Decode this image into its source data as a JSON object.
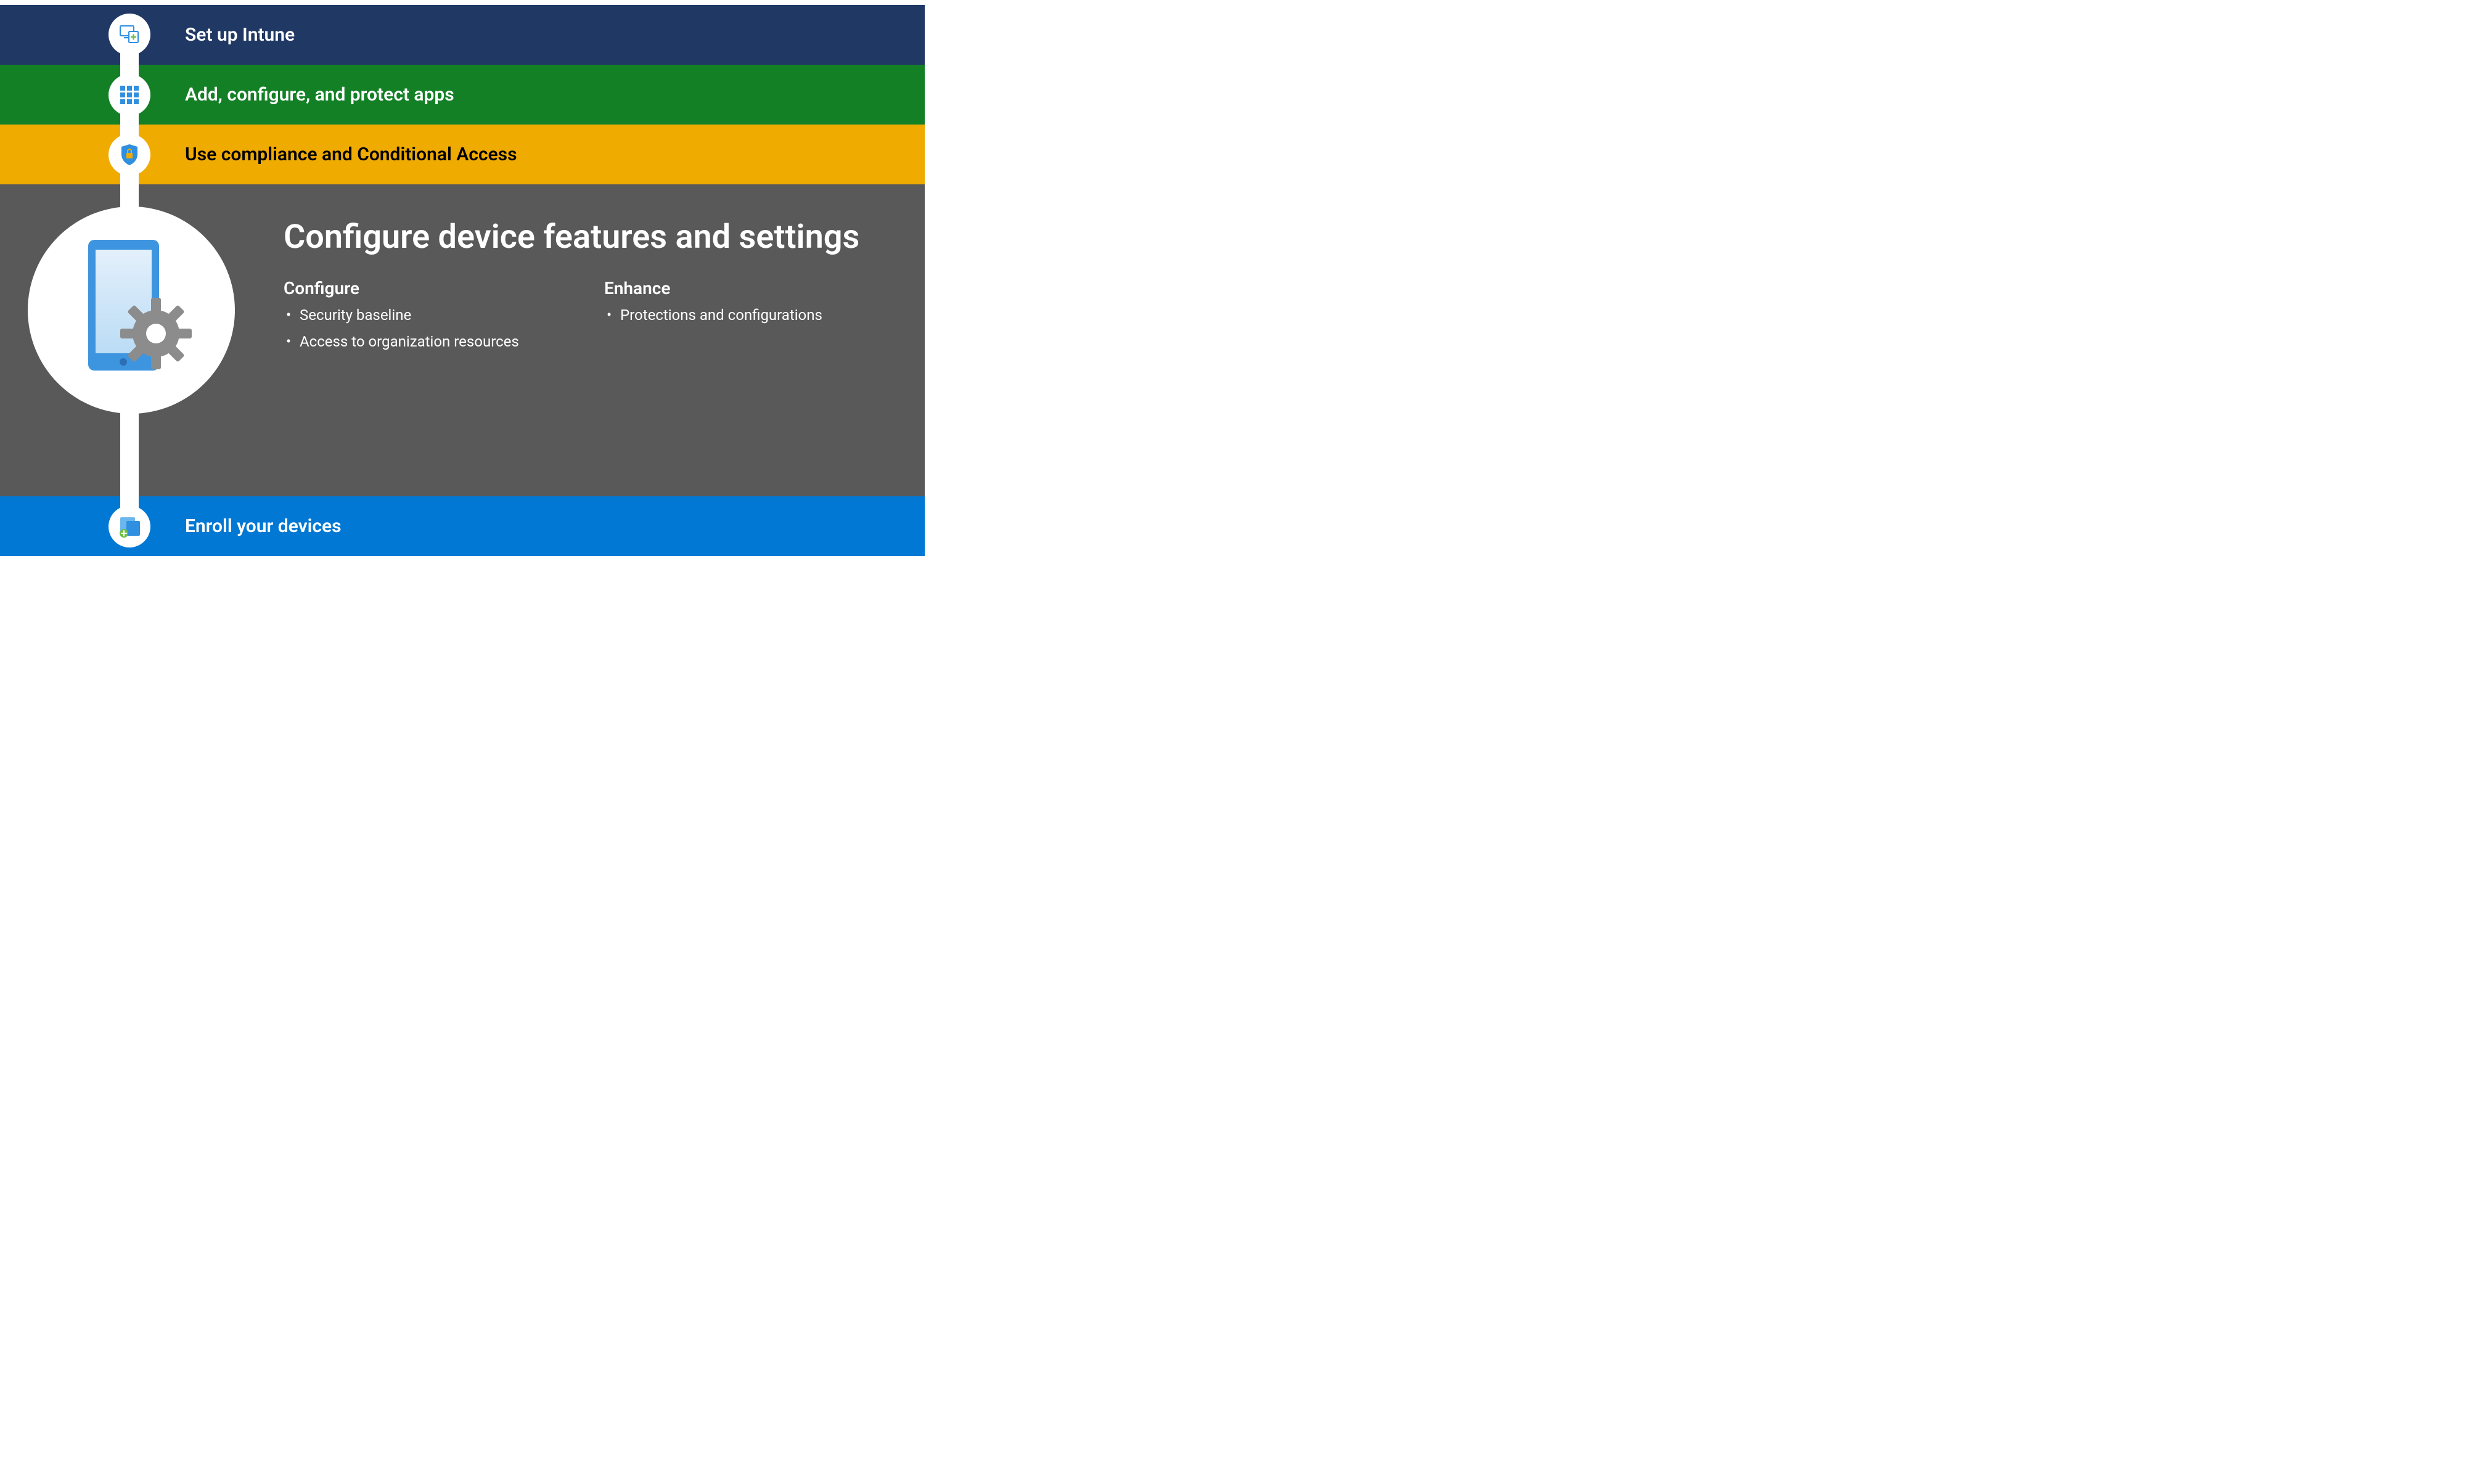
{
  "steps": {
    "setup": {
      "label": "Set up Intune"
    },
    "apps": {
      "label": "Add, configure, and protect apps"
    },
    "comply": {
      "label": "Use compliance and Conditional Access"
    },
    "enroll": {
      "label": "Enroll your devices"
    }
  },
  "active": {
    "title": "Configure device features and settings",
    "columns": [
      {
        "heading": "Configure",
        "items": [
          "Security baseline",
          "Access to organization resources"
        ]
      },
      {
        "heading": "Enhance",
        "items": [
          "Protections and configurations"
        ]
      }
    ]
  },
  "icons": {
    "setup": "monitor-device-icon",
    "apps": "apps-grid-icon",
    "comply": "shield-lock-icon",
    "enroll": "device-add-icon",
    "active": "phone-gear-icon"
  },
  "colors": {
    "step1": "#203864",
    "step2": "#138026",
    "step3": "#F0AB00",
    "step4": "#595959",
    "step5": "#0078D4",
    "accent": "#0078D4"
  }
}
